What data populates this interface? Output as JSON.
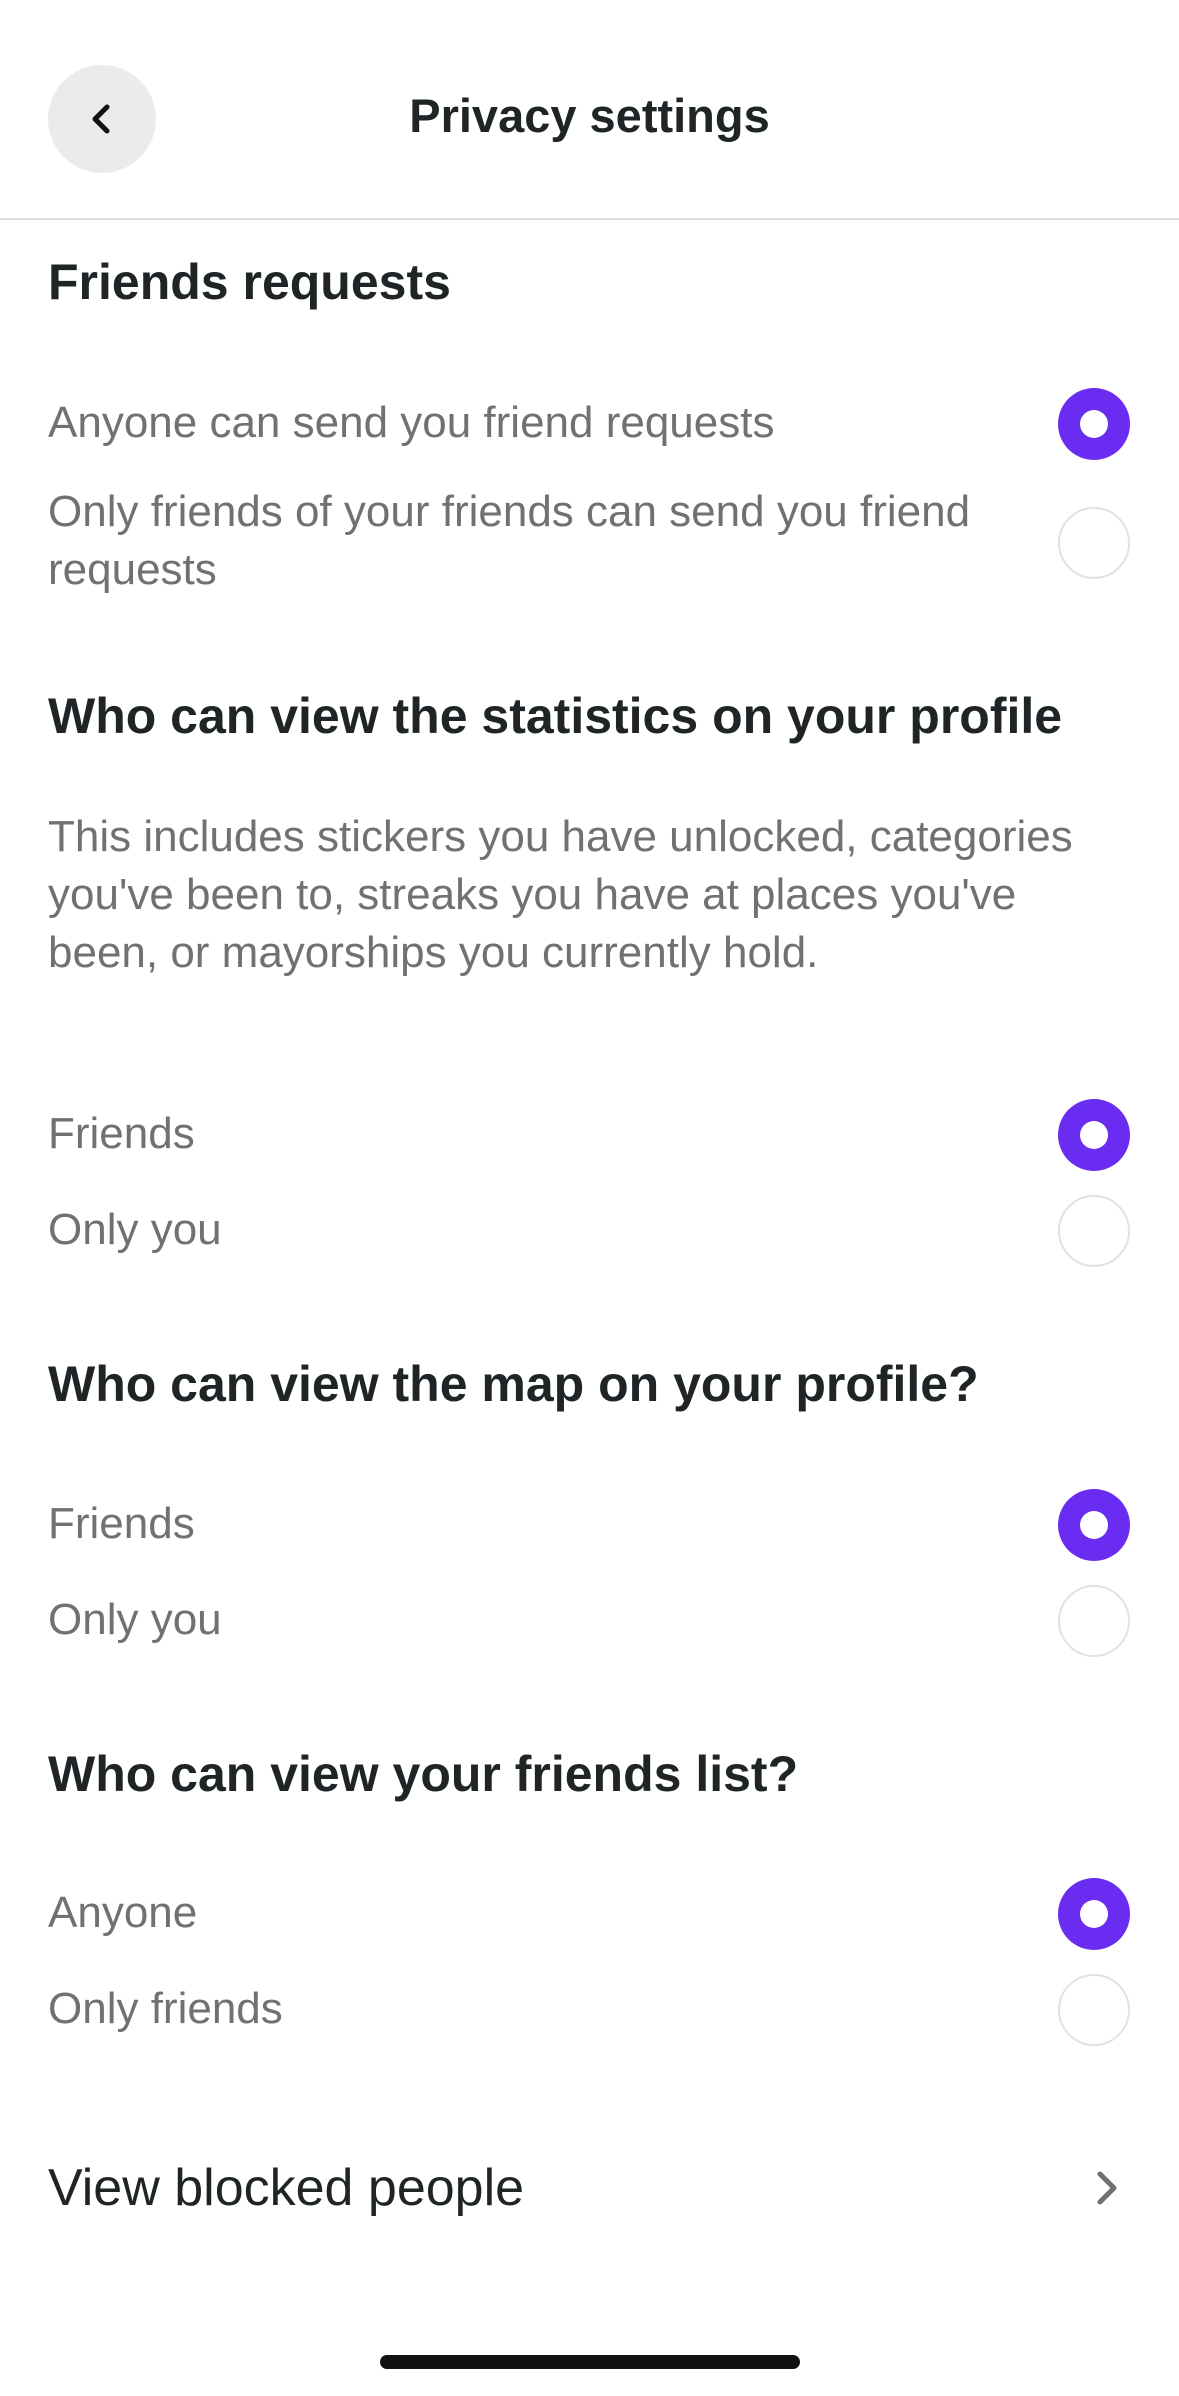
{
  "header": {
    "title": "Privacy settings",
    "back_icon": "chevron-left-icon"
  },
  "friend_requests": {
    "heading": "Friends requests",
    "options": [
      {
        "label": "Anyone can send you friend requests",
        "selected": true
      },
      {
        "label": "Only friends of your friends can send you friend requests",
        "selected": false
      }
    ]
  },
  "statistics": {
    "heading": "Who can view the statistics on your profile",
    "description": "This includes stickers you have unlocked, categories you've been to, streaks you have at places you've been, or mayorships you currently hold.",
    "options": [
      {
        "label": "Friends",
        "selected": true
      },
      {
        "label": "Only you",
        "selected": false
      }
    ]
  },
  "map": {
    "heading": "Who can view the map on your profile?",
    "options": [
      {
        "label": "Friends",
        "selected": true
      },
      {
        "label": "Only you",
        "selected": false
      }
    ]
  },
  "friends_list": {
    "heading": "Who can view your friends list?",
    "options": [
      {
        "label": "Anyone",
        "selected": true
      },
      {
        "label": "Only friends",
        "selected": false
      }
    ]
  },
  "blocked": {
    "label": "View blocked people",
    "icon": "chevron-right-icon"
  },
  "colors": {
    "accent": "#6a2cf0",
    "heading_text": "#1f2426",
    "secondary_text": "#6f7173",
    "divider": "#dcdcdc"
  }
}
